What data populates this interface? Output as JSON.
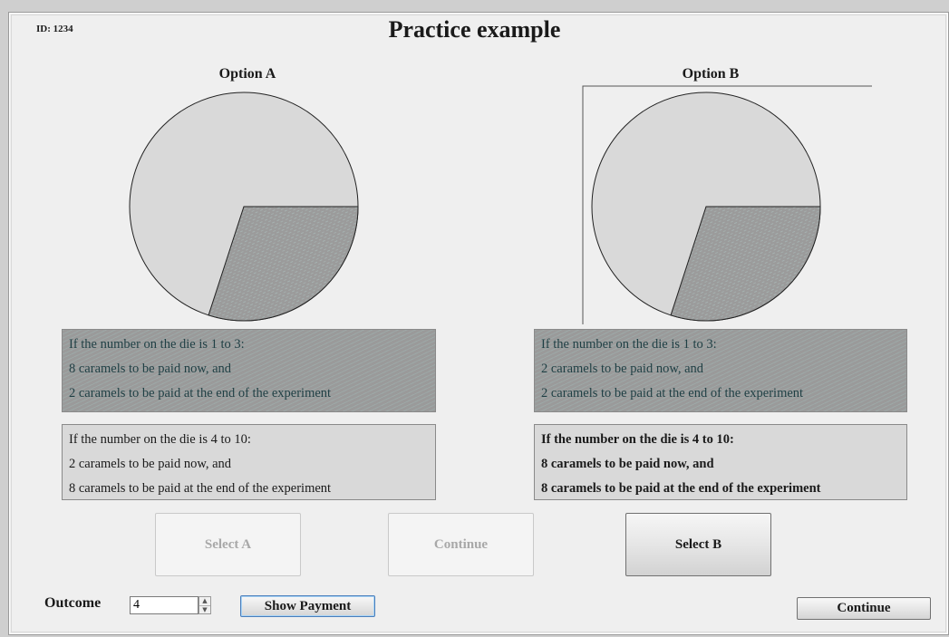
{
  "header": {
    "subject_id": "ID: 1234",
    "title": "Practice example"
  },
  "options": [
    {
      "title": "Option A",
      "pie_shaded_fraction": 0.3,
      "first_outcome": {
        "lines": [
          "If the number on the die is 1 to 3:",
          "8 caramels to be paid now, and",
          "2 caramels to be paid at the end of the experiment"
        ]
      },
      "second_outcome": {
        "lines": [
          "If the number on the die is 4 to 10:",
          "2 caramels to be paid now, and",
          "8 caramels to be paid at the end of the experiment"
        ]
      }
    },
    {
      "title": "Option B",
      "pie_shaded_fraction": 0.3,
      "first_outcome": {
        "lines": [
          "If the number on the die is 1 to 3:",
          "2 caramels to be paid now, and",
          "2 caramels to be paid at the end of the experiment"
        ]
      },
      "second_outcome": {
        "lines": [
          "If the number on the die is 4 to 10:",
          "8 caramels to be paid now, and",
          "8 caramels to be paid at the end of the experiment"
        ]
      }
    }
  ],
  "buttons": {
    "select_a": "Select A",
    "continue_middle": "Continue",
    "select_b": "Select B",
    "show_payment": "Show Payment",
    "continue_bottom": "Continue"
  },
  "outcome": {
    "label": "Outcome",
    "value": "4"
  },
  "colors": {
    "pie_light": "#d9d9d9",
    "pie_shaded": "#9b9b9b",
    "box_shaded": "#9a9a9a",
    "box_light": "#d9d9d9"
  }
}
